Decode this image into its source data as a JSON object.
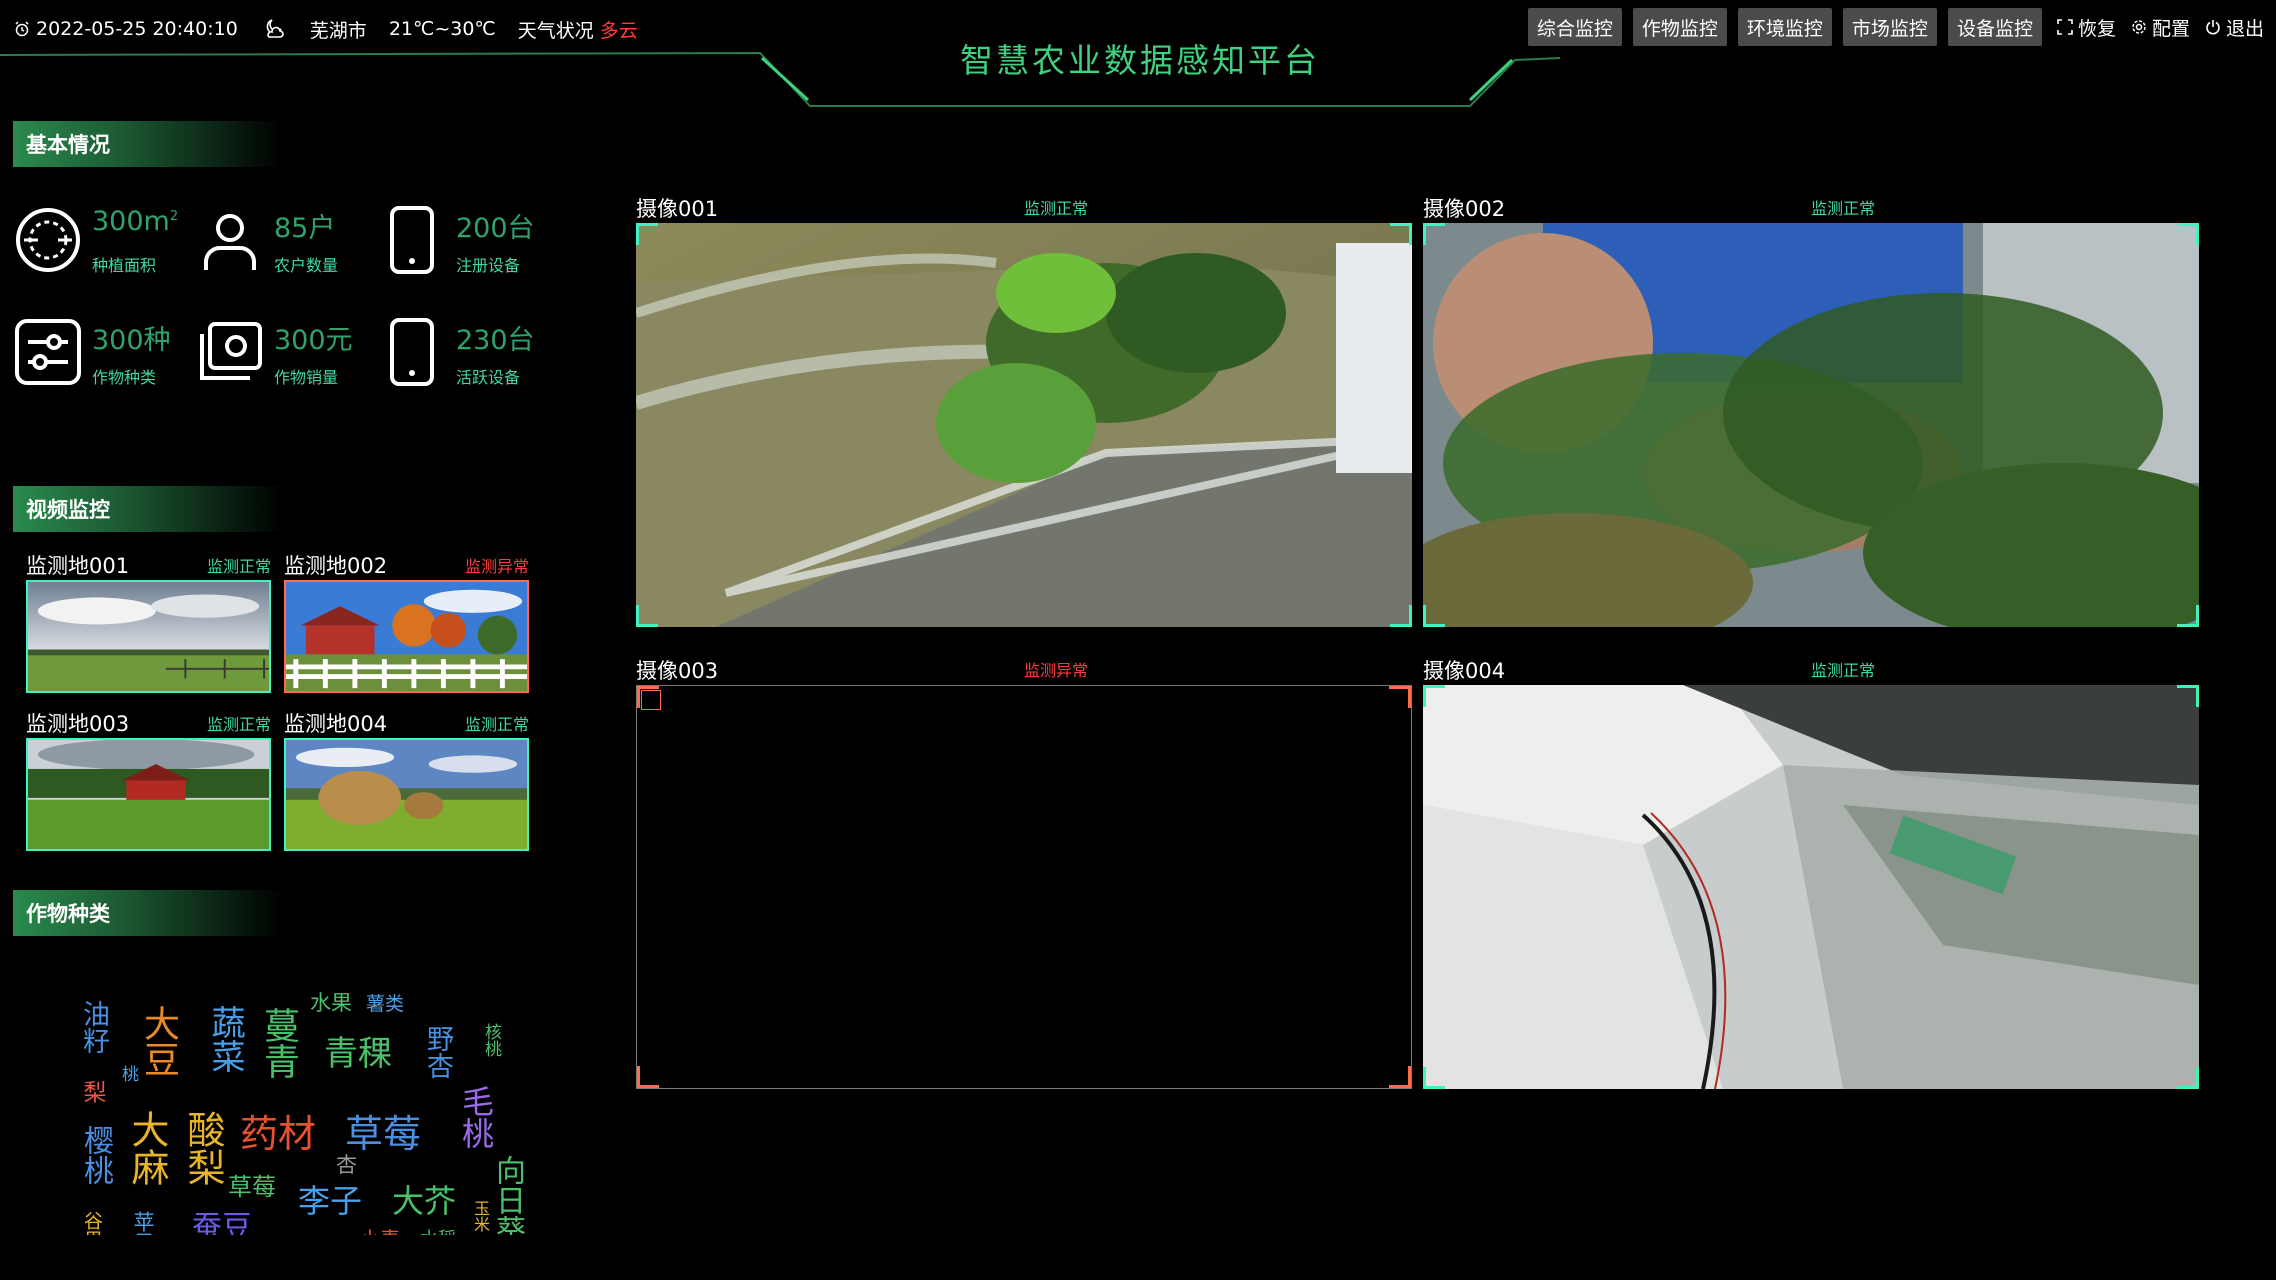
{
  "header": {
    "datetime": "2022-05-25 20:40:10",
    "city": "芜湖市",
    "temperature": "21℃~30℃",
    "weather_label": "天气状况",
    "weather_value": "多云",
    "title": "智慧农业数据感知平台",
    "tabs": [
      "综合监控",
      "作物监控",
      "环境监控",
      "市场监控",
      "设备监控"
    ],
    "actions": {
      "restore": "恢复",
      "config": "配置",
      "exit": "退出"
    }
  },
  "basic": {
    "title": "基本情况",
    "area": {
      "value": "300m",
      "sup": "2",
      "label": "种植面积"
    },
    "farmers": {
      "value": "85户",
      "label": "农户数量"
    },
    "registered": {
      "value": "200台",
      "label": "注册设备"
    },
    "crop_types": {
      "value": "300种",
      "label": "作物种类"
    },
    "sales": {
      "value": "300元",
      "label": "作物销量"
    },
    "active": {
      "value": "230台",
      "label": "活跃设备"
    }
  },
  "video": {
    "title": "视频监控",
    "sites": [
      {
        "name": "监测地001",
        "status": "监测正常"
      },
      {
        "name": "监测地002",
        "status": "监测异常"
      },
      {
        "name": "监测地003",
        "status": "监测正常"
      },
      {
        "name": "监测地004",
        "status": "监测正常"
      }
    ]
  },
  "crops": {
    "title": "作物种类",
    "words": [
      "油籽",
      "大豆",
      "蔬菜",
      "蔓青",
      "水果",
      "薯类",
      "青稞",
      "野杏",
      "核桃",
      "桃",
      "梨",
      "樱桃",
      "大麻",
      "酸梨",
      "药材",
      "草莓",
      "毛桃",
      "杏",
      "草莓",
      "李子",
      "大芥",
      "向日葵",
      "玉米",
      "蚕豆",
      "谷果",
      "苹果",
      "小麦",
      "水稻"
    ]
  },
  "cameras": [
    {
      "name": "摄像001",
      "status": "监测正常"
    },
    {
      "name": "摄像002",
      "status": "监测正常"
    },
    {
      "name": "摄像003",
      "status": "监测异常"
    },
    {
      "name": "摄像004",
      "status": "监测正常"
    }
  ],
  "colors": {
    "accent": "#3fd17f",
    "ok": "#3fd9a0",
    "bad": "#ff3b3b",
    "frame_ok": "#3ff2c0",
    "frame_bad": "#ff6b4b"
  }
}
